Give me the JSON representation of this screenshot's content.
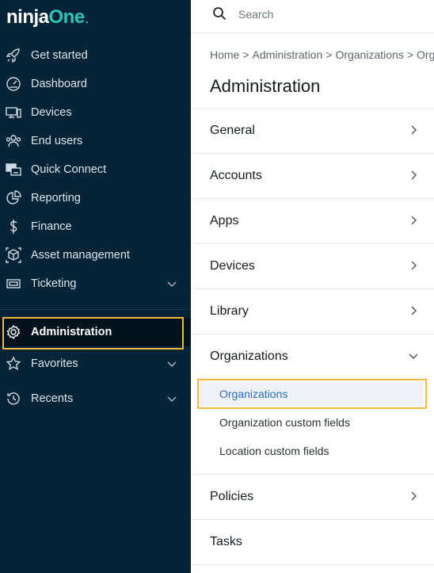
{
  "brand": {
    "part1": "ninja",
    "part2": "One",
    "accent": "#2ec4b6"
  },
  "sidebar": {
    "items": [
      {
        "label": "Get started",
        "icon": "rocket-icon"
      },
      {
        "label": "Dashboard",
        "icon": "gauge-icon"
      },
      {
        "label": "Devices",
        "icon": "devices-icon"
      },
      {
        "label": "End users",
        "icon": "users-icon"
      },
      {
        "label": "Quick Connect",
        "icon": "quick-connect-icon"
      },
      {
        "label": "Reporting",
        "icon": "pie-chart-icon"
      },
      {
        "label": "Finance",
        "icon": "dollar-icon"
      },
      {
        "label": "Asset management",
        "icon": "box-icon"
      },
      {
        "label": "Ticketing",
        "icon": "ticket-icon"
      },
      {
        "label": "Administration",
        "icon": "gear-icon"
      },
      {
        "label": "Favorites",
        "icon": "star-icon"
      },
      {
        "label": "Recents",
        "icon": "history-icon"
      }
    ],
    "active": "Administration"
  },
  "search": {
    "placeholder": "Search"
  },
  "breadcrumb": {
    "items": [
      "Home",
      "Administration",
      "Organizations",
      "Organizations"
    ]
  },
  "page": {
    "title": "Administration"
  },
  "admin_sections": [
    {
      "label": "General"
    },
    {
      "label": "Accounts"
    },
    {
      "label": "Apps"
    },
    {
      "label": "Devices"
    },
    {
      "label": "Library"
    },
    {
      "label": "Organizations",
      "expanded": true
    },
    {
      "label": "Policies"
    },
    {
      "label": "Tasks"
    }
  ],
  "organizations_sub": {
    "items": [
      "Organizations",
      "Organization custom fields",
      "Location custom fields"
    ],
    "selected": "Organizations"
  },
  "colors": {
    "sidebar_bg": "#062438",
    "highlight": "#f5b83d",
    "link": "#2a70b8"
  }
}
